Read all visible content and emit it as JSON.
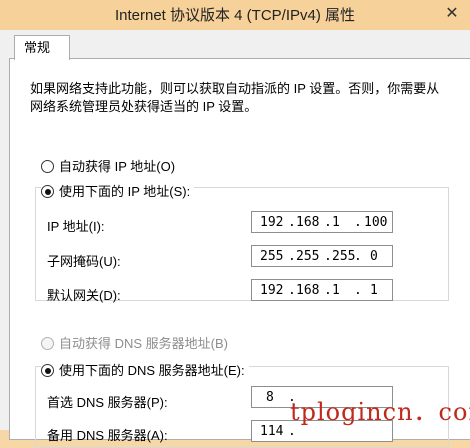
{
  "window": {
    "title": "Internet 协议版本 4 (TCP/IPv4) 属性",
    "close_glyph": "✕"
  },
  "tabs": [
    {
      "label": "常规"
    }
  ],
  "description": "如果网络支持此功能，则可以获取自动指派的 IP 设置。否则，你需要从网络系统管理员处获得适当的 IP 设置。",
  "ip_section": {
    "auto_label": "自动获得 IP 地址(O)",
    "manual_label": "使用下面的 IP 地址(S):",
    "selected": "manual",
    "fields": [
      {
        "label": "IP 地址(I):",
        "octets": [
          "192",
          "168",
          "1",
          "100"
        ]
      },
      {
        "label": "子网掩码(U):",
        "octets": [
          "255",
          "255",
          "255",
          "0"
        ]
      },
      {
        "label": "默认网关(D):",
        "octets": [
          "192",
          "168",
          "1",
          "1"
        ]
      }
    ]
  },
  "dns_section": {
    "auto_label": "自动获得 DNS 服务器地址(B)",
    "auto_enabled": false,
    "manual_label": "使用下面的 DNS 服务器地址(E):",
    "selected": "manual",
    "fields": [
      {
        "label": "首选 DNS 服务器(P):",
        "octets": [
          "8",
          ".",
          "",
          ""
        ]
      },
      {
        "label": "备用 DNS 服务器(A):",
        "octets": [
          "114",
          ".",
          "",
          ""
        ]
      }
    ]
  },
  "watermark": "tplogincn．com",
  "colors": {
    "titlebar": "#f6d19a",
    "watermark": "#bf2a1c"
  }
}
